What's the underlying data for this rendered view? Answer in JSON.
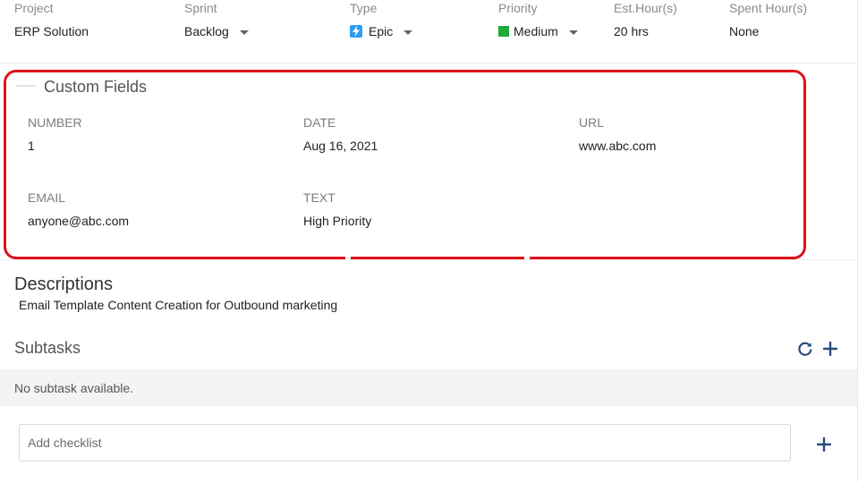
{
  "meta": {
    "project": {
      "label": "Project",
      "value": "ERP Solution"
    },
    "sprint": {
      "label": "Sprint",
      "value": "Backlog"
    },
    "type": {
      "label": "Type",
      "value": "Epic",
      "icon": "lightning-icon",
      "color": "#2a9df4"
    },
    "priority": {
      "label": "Priority",
      "value": "Medium",
      "color": "#1faa3a"
    },
    "est_hours": {
      "label": "Est.Hour(s)",
      "value": "20 hrs"
    },
    "spent_hours": {
      "label": "Spent Hour(s)",
      "value": "None"
    }
  },
  "custom_fields": {
    "title": "Custom Fields",
    "fields": [
      {
        "label": "NUMBER",
        "value": "1"
      },
      {
        "label": "DATE",
        "value": "Aug 16, 2021"
      },
      {
        "label": "URL",
        "value": "www.abc.com"
      },
      {
        "label": "EMAIL",
        "value": "anyone@abc.com"
      },
      {
        "label": "TEXT",
        "value": "High Priority"
      }
    ],
    "highlight_color": "#e0121b"
  },
  "descriptions": {
    "title": "Descriptions",
    "text": "Email Template Content Creation for Outbound marketing"
  },
  "subtasks": {
    "title": "Subtasks",
    "empty_message": "No subtask available.",
    "icons": [
      "refresh-icon",
      "plus-icon"
    ]
  },
  "checklist": {
    "placeholder": "Add checklist",
    "add_icon": "plus-icon"
  },
  "colors": {
    "icon_accent": "#2c4a7a"
  }
}
